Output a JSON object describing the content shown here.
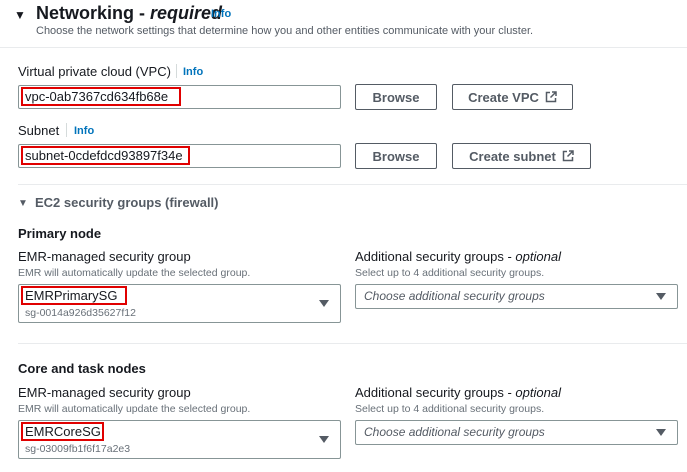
{
  "header": {
    "title": "Networking - ",
    "title_emphasis": "required",
    "info": "Info",
    "description": "Choose the network settings that determine how you and other entities communicate with your cluster."
  },
  "vpc": {
    "label": "Virtual private cloud (VPC)",
    "info": "Info",
    "value": "vpc-0ab7367cd634fb68e",
    "browse_label": "Browse",
    "create_label": "Create VPC"
  },
  "subnet": {
    "label": "Subnet",
    "info": "Info",
    "value": "subnet-0cdefdcd93897f34e",
    "browse_label": "Browse",
    "create_label": "Create subnet"
  },
  "security_groups": {
    "title": "EC2 security groups (firewall)",
    "primary": {
      "heading": "Primary node",
      "managed_label": "EMR-managed security group",
      "managed_hint": "EMR will automatically update the selected group.",
      "managed_value": "EMRPrimarySG",
      "managed_id": "sg-0014a926d35627f12",
      "additional_label": "Additional security groups - ",
      "additional_label_optional": "optional",
      "additional_hint": "Select up to 4 additional security groups.",
      "additional_placeholder": "Choose additional security groups"
    },
    "core": {
      "heading": "Core and task nodes",
      "managed_label": "EMR-managed security group",
      "managed_hint": "EMR will automatically update the selected group.",
      "managed_value": "EMRCoreSG",
      "managed_id": "sg-03009fb1f6f17a2e3",
      "additional_label": "Additional security groups - ",
      "additional_label_optional": "optional",
      "additional_hint": "Select up to 4 additional security groups.",
      "additional_placeholder": "Choose additional security groups"
    }
  },
  "icons": {
    "collapse": "caret-down-icon",
    "external": "external-link-icon",
    "dropdown": "dropdown-arrow-icon"
  },
  "colors": {
    "link": "#0073bb",
    "highlight": "#e00000",
    "text": "#16191f",
    "muted": "#687078"
  }
}
